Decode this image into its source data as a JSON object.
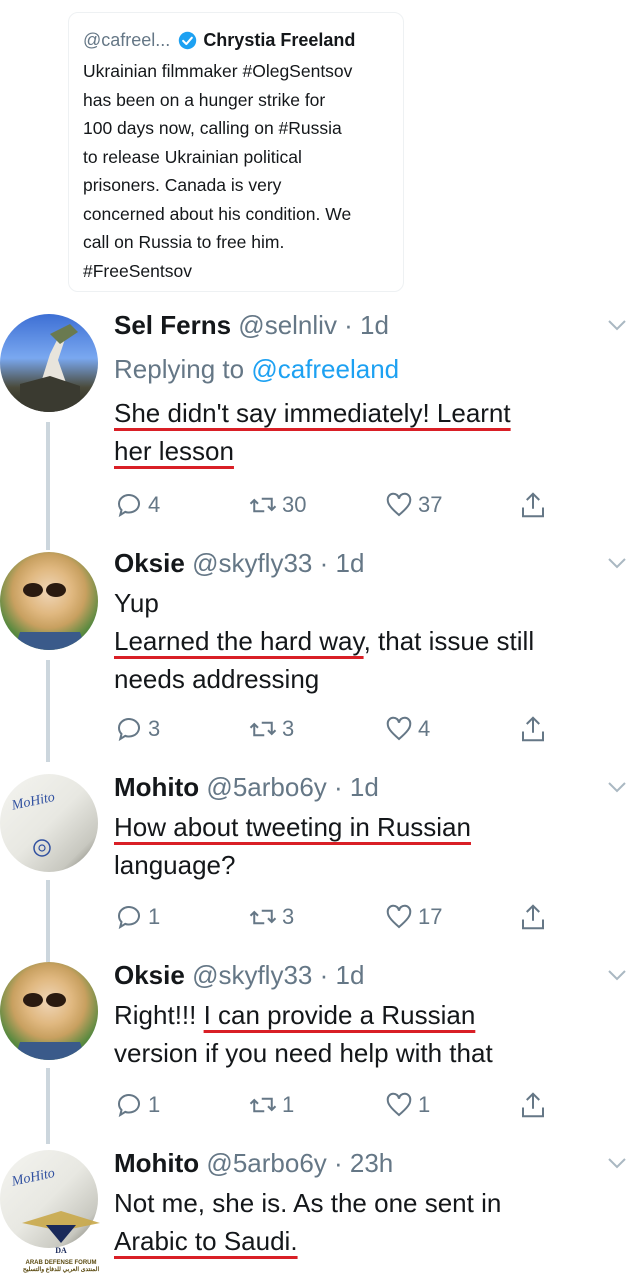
{
  "quoted": {
    "handle": "@cafreel...",
    "name": "Chrystia Freeland",
    "text": "Ukrainian filmmaker #OlegSentsov\nhas been on a hunger strike for\n100 days now, calling on #Russia\nto release Ukrainian political\nprisoners. Canada is very\nconcerned about his condition. We\ncall on Russia to free him.\n#FreeSentsov"
  },
  "replies": [
    {
      "name": "Sel Ferns",
      "meta": "@selnliv · 1d",
      "replying_prefix": "Replying to ",
      "replying_handle": "@cafreeland",
      "text_ul": "She didn't say immediately! Learnt",
      "text_ul2": "her lesson",
      "reply_count": "4",
      "retweet_count": "30",
      "like_count": "37"
    },
    {
      "name": "Oksie",
      "meta": "@skyfly33 · 1d",
      "line1": "Yup",
      "text_ul": "Learned the hard way",
      "text_rest": ", that issue still",
      "line3": "needs addressing",
      "reply_count": "3",
      "retweet_count": "3",
      "like_count": "4"
    },
    {
      "name": "Mohito",
      "meta": "@5arbo6y · 1d",
      "text_ul": "How about tweeting in Russian",
      "line2": "language?",
      "reply_count": "1",
      "retweet_count": "3",
      "like_count": "17"
    },
    {
      "name": "Oksie",
      "meta": "@skyfly33 · 1d",
      "text_pre": "Right!!! ",
      "text_ul": "I can provide a Russian",
      "line2": "version if you need help with that",
      "reply_count": "1",
      "retweet_count": "1",
      "like_count": "1"
    },
    {
      "name": "Mohito",
      "meta": "@5arbo6y · 23h",
      "line1": "Not me, she is. As the one sent in",
      "text_ul": "Arabic to Saudi."
    }
  ],
  "watermark": {
    "logo": "DA",
    "line1": "ARAB DEFENSE FORUM",
    "line2": "المنتدى العربي للدفاع والتسليح"
  },
  "colors": {
    "accent": "#1da1f2",
    "underline": "#d91f26",
    "muted": "#657786"
  }
}
